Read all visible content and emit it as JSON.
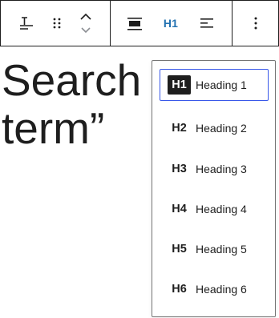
{
  "toolbar": {
    "buttons": [
      {
        "name": "paragraph-transform",
        "icon": "text-transform-icon"
      },
      {
        "name": "drag-handle",
        "icon": "drag-dots-icon"
      },
      {
        "name": "move-up-down",
        "icon": "chevron-up-down-icon"
      },
      {
        "name": "block-align",
        "icon": "align-wide-icon"
      },
      {
        "name": "heading-level",
        "label": "H1",
        "color": "#2271b1"
      },
      {
        "name": "text-align",
        "icon": "align-left-icon"
      },
      {
        "name": "more-options",
        "icon": "vertical-ellipsis-icon"
      }
    ]
  },
  "editor": {
    "heading_line1": "Search",
    "heading_line2": "term”"
  },
  "heading_menu": {
    "selected": "H1",
    "items": [
      {
        "tag": "H1",
        "label": "Heading 1"
      },
      {
        "tag": "H2",
        "label": "Heading 2"
      },
      {
        "tag": "H3",
        "label": "Heading 3"
      },
      {
        "tag": "H4",
        "label": "Heading 4"
      },
      {
        "tag": "H5",
        "label": "Heading 5"
      },
      {
        "tag": "H6",
        "label": "Heading 6"
      }
    ]
  },
  "colors": {
    "accent": "#3858e9",
    "text": "#1e1e1e",
    "border": "#757575"
  }
}
